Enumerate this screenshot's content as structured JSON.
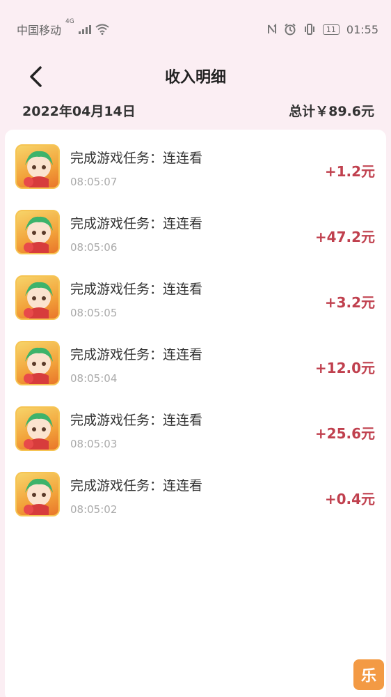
{
  "status_bar": {
    "carrier": "中国移动",
    "network": "4G",
    "battery": "11",
    "time": "01:55"
  },
  "header": {
    "title": "收入明细"
  },
  "summary": {
    "date": "2022年04月14日",
    "total": "总计￥89.6元"
  },
  "records": [
    {
      "title": "完成游戏任务：连连看",
      "time": "08:05:07",
      "amount": "+1.2元"
    },
    {
      "title": "完成游戏任务：连连看",
      "time": "08:05:06",
      "amount": "+47.2元"
    },
    {
      "title": "完成游戏任务：连连看",
      "time": "08:05:05",
      "amount": "+3.2元"
    },
    {
      "title": "完成游戏任务：连连看",
      "time": "08:05:04",
      "amount": "+12.0元"
    },
    {
      "title": "完成游戏任务：连连看",
      "time": "08:05:03",
      "amount": "+25.6元"
    },
    {
      "title": "完成游戏任务：连连看",
      "time": "08:05:02",
      "amount": "+0.4元"
    }
  ],
  "fab": {
    "label": "乐"
  },
  "colors": {
    "accent": "#c0404e",
    "background": "#fbeef3"
  }
}
